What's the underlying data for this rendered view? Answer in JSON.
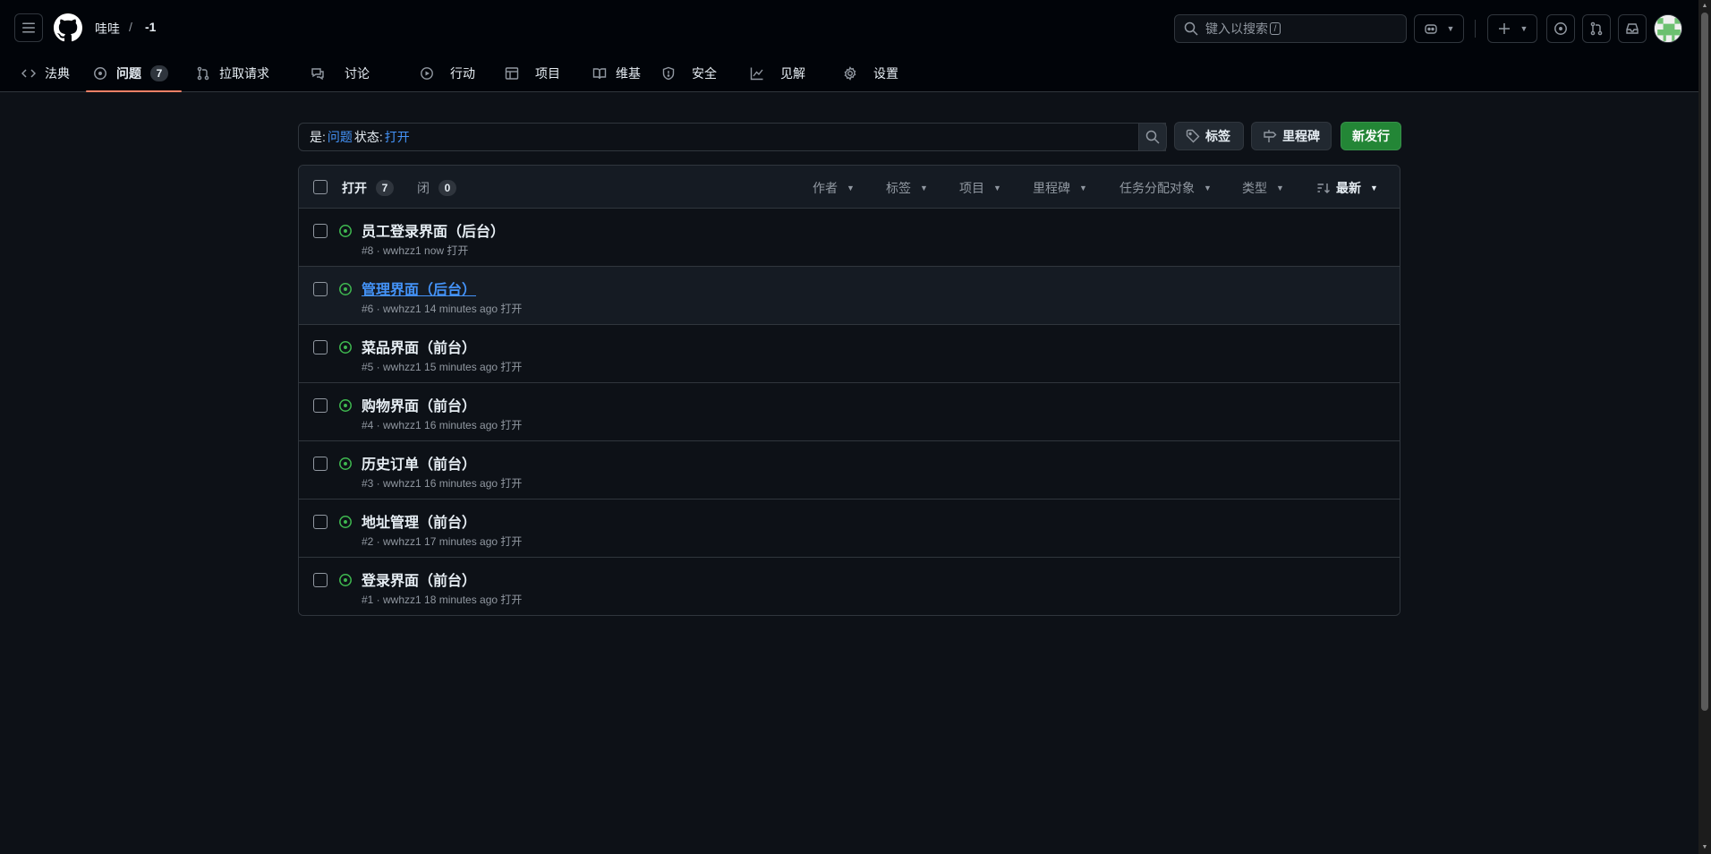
{
  "header": {
    "owner": "哇哇",
    "separator": "/",
    "repo": "-1",
    "search_placeholder": "键入以搜索",
    "search_shortcut": "/"
  },
  "tabs": [
    {
      "label": "法典",
      "icon": "code-icon"
    },
    {
      "label": "问题",
      "icon": "issue-opened-icon",
      "count": "7"
    },
    {
      "label": "拉取请求",
      "icon": "git-pull-request-icon"
    },
    {
      "label": "讨论",
      "icon": "comment-discussion-icon"
    },
    {
      "label": "行动",
      "icon": "play-icon"
    },
    {
      "label": "项目",
      "icon": "table-icon"
    },
    {
      "label": "维基",
      "icon": "book-icon"
    },
    {
      "label": "安全",
      "icon": "shield-icon"
    },
    {
      "label": "见解",
      "icon": "graph-icon"
    },
    {
      "label": "设置",
      "icon": "gear-icon"
    }
  ],
  "filter": {
    "prefix_is": "是:",
    "value_is": "问题",
    "prefix_state": "状态:",
    "value_state": "打开"
  },
  "buttons": {
    "labels": "标签",
    "milestones": "里程碑",
    "new_issue": "新发行"
  },
  "list_header": {
    "open_label": "打开",
    "open_count": "7",
    "closed_label": "闭",
    "closed_count": "0",
    "filters": [
      "作者",
      "标签",
      "项目",
      "里程碑",
      "任务分配对象",
      "类型"
    ],
    "sort_label": "最新"
  },
  "issues": [
    {
      "title": "员工登录界面（后台）",
      "meta": "#8 · wwhzz1 now 打开"
    },
    {
      "title": "管理界面（后台）",
      "meta": "#6 · wwhzz1 14 minutes ago 打开"
    },
    {
      "title": "菜品界面（前台）",
      "meta": "#5 · wwhzz1 15 minutes ago 打开"
    },
    {
      "title": "购物界面（前台）",
      "meta": "#4 · wwhzz1 16 minutes ago 打开"
    },
    {
      "title": "历史订单（前台）",
      "meta": "#3 · wwhzz1 16 minutes ago 打开"
    },
    {
      "title": "地址管理（前台）",
      "meta": "#2 · wwhzz1 17 minutes ago 打开"
    },
    {
      "title": "登录界面（前台）",
      "meta": "#1 · wwhzz1 18 minutes ago 打开"
    }
  ],
  "colors": {
    "background": "#0d1117",
    "header_bg": "#010409",
    "border": "#30363d",
    "link_blue": "#4493f8",
    "open_green": "#3fb950",
    "primary_button": "#238636",
    "active_tab_underline": "#f78166"
  }
}
